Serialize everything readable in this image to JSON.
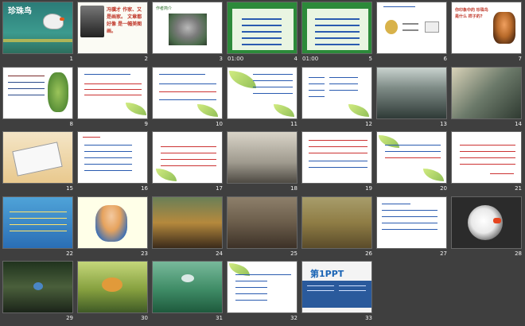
{
  "slides": [
    {
      "num": "1",
      "title": "珍珠鸟"
    },
    {
      "num": "2",
      "text": "冯骥才 作家、又是画家。 文章都好像 是一幅美图画。"
    },
    {
      "num": "3",
      "heading": "作者简介"
    },
    {
      "num": "4",
      "timer": "01:00"
    },
    {
      "num": "5",
      "timer": "01:00"
    },
    {
      "num": "6"
    },
    {
      "num": "7",
      "question": "你印象中的 珍珠鸟是什么 样子的?"
    },
    {
      "num": "8"
    },
    {
      "num": "9"
    },
    {
      "num": "10"
    },
    {
      "num": "11"
    },
    {
      "num": "12"
    },
    {
      "num": "13"
    },
    {
      "num": "14"
    },
    {
      "num": "15"
    },
    {
      "num": "16"
    },
    {
      "num": "17"
    },
    {
      "num": "18"
    },
    {
      "num": "19"
    },
    {
      "num": "20"
    },
    {
      "num": "21"
    },
    {
      "num": "22"
    },
    {
      "num": "23"
    },
    {
      "num": "24"
    },
    {
      "num": "25"
    },
    {
      "num": "26"
    },
    {
      "num": "27"
    },
    {
      "num": "28"
    },
    {
      "num": "29"
    },
    {
      "num": "30"
    },
    {
      "num": "31"
    },
    {
      "num": "32"
    },
    {
      "num": "33",
      "brand": "第1PPT"
    }
  ]
}
